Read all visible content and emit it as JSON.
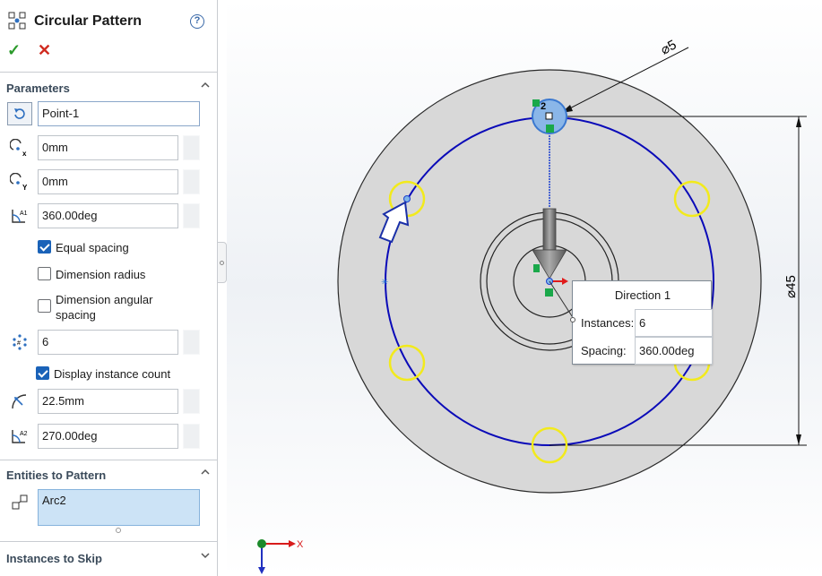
{
  "panel": {
    "title": "Circular Pattern",
    "help": "?",
    "ok": "✓",
    "cancel": "✕"
  },
  "parameters": {
    "heading": "Parameters",
    "center": "Point-1",
    "x_offset": "0mm",
    "y_offset": "0mm",
    "angle": "360.00deg",
    "equal_spacing_label": "Equal spacing",
    "equal_spacing": true,
    "dimension_radius_label": "Dimension radius",
    "dimension_radius": false,
    "dimension_angular_label": "Dimension angular spacing",
    "dimension_angular": false,
    "instances": "6",
    "display_count_label": "Display instance count",
    "display_count": true,
    "radius": "22.5mm",
    "arc_angle": "270.00deg"
  },
  "entities": {
    "heading": "Entities to Pattern",
    "value": "Arc2"
  },
  "skip": {
    "heading": "Instances to Skip"
  },
  "viewport": {
    "diameter_small": "⌀5",
    "diameter_large": "⌀45",
    "instance_marker": "2",
    "x_label": "X",
    "callout": {
      "title": "Direction 1",
      "instances_label": "Instances:",
      "instances_value": "6",
      "spacing_label": "Spacing:",
      "spacing_value": "360.00deg"
    }
  },
  "colors": {
    "pattern_circle": "#0a0ab8",
    "instance": "#f2ea1c",
    "disk": "#d8d8d8",
    "selection": "#8ab6e8",
    "accent_check": "#1a62b8"
  }
}
